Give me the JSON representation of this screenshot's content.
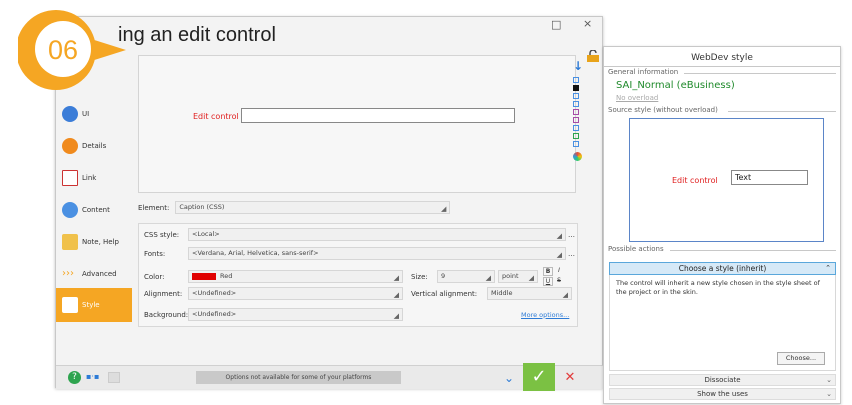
{
  "badge": {
    "number": "06",
    "color": "#f5a623"
  },
  "dialog": {
    "title": "ing an edit control",
    "sidebar": [
      {
        "label": "UI",
        "icon": "ui-icon"
      },
      {
        "label": "Details",
        "icon": "details-icon"
      },
      {
        "label": "Link",
        "icon": "link-icon"
      },
      {
        "label": "Content",
        "icon": "content-icon"
      },
      {
        "label": "Note, Help",
        "icon": "note-icon"
      },
      {
        "label": "Advanced",
        "icon": "advanced-icon"
      },
      {
        "label": "Style",
        "icon": "style-icon",
        "active": true
      }
    ],
    "preview": {
      "label": "Edit control"
    },
    "element": {
      "label": "Element:",
      "value": "Caption (CSS)"
    },
    "props": {
      "css_style_label": "CSS style:",
      "css_style_value": "<Local>",
      "fonts_label": "Fonts:",
      "fonts_value": "<Verdana, Arial, Helvetica, sans-serif>",
      "color_label": "Color:",
      "color_value": "Red",
      "size_label": "Size:",
      "size_value": "9",
      "size_unit": "point",
      "bold": "B",
      "italic": "I",
      "underline": "U",
      "strike": "S",
      "alignment_label": "Alignment:",
      "alignment_value": "<Undefined>",
      "valign_label": "Vertical alignment:",
      "valign_value": "Middle",
      "background_label": "Background:",
      "background_value": "<Undefined>",
      "more_options": "More options..."
    },
    "footer": {
      "not_available": "Options not available for some of your platforms"
    }
  },
  "panel": {
    "title": "WebDev style",
    "general_info": "General information",
    "style_name": "SAI_Normal (eBusiness)",
    "no_overload": "No overload",
    "source_style": "Source style (without overload)",
    "src_label": "Edit control",
    "src_input": "Text",
    "possible_actions": "Possible actions",
    "choose_head": "Choose a style (inherit)",
    "description": "The control will inherit a new style chosen in the style sheet of the project or in the skin.",
    "choose_button": "Choose...",
    "dissociate": "Dissociate",
    "show_uses": "Show the uses"
  }
}
